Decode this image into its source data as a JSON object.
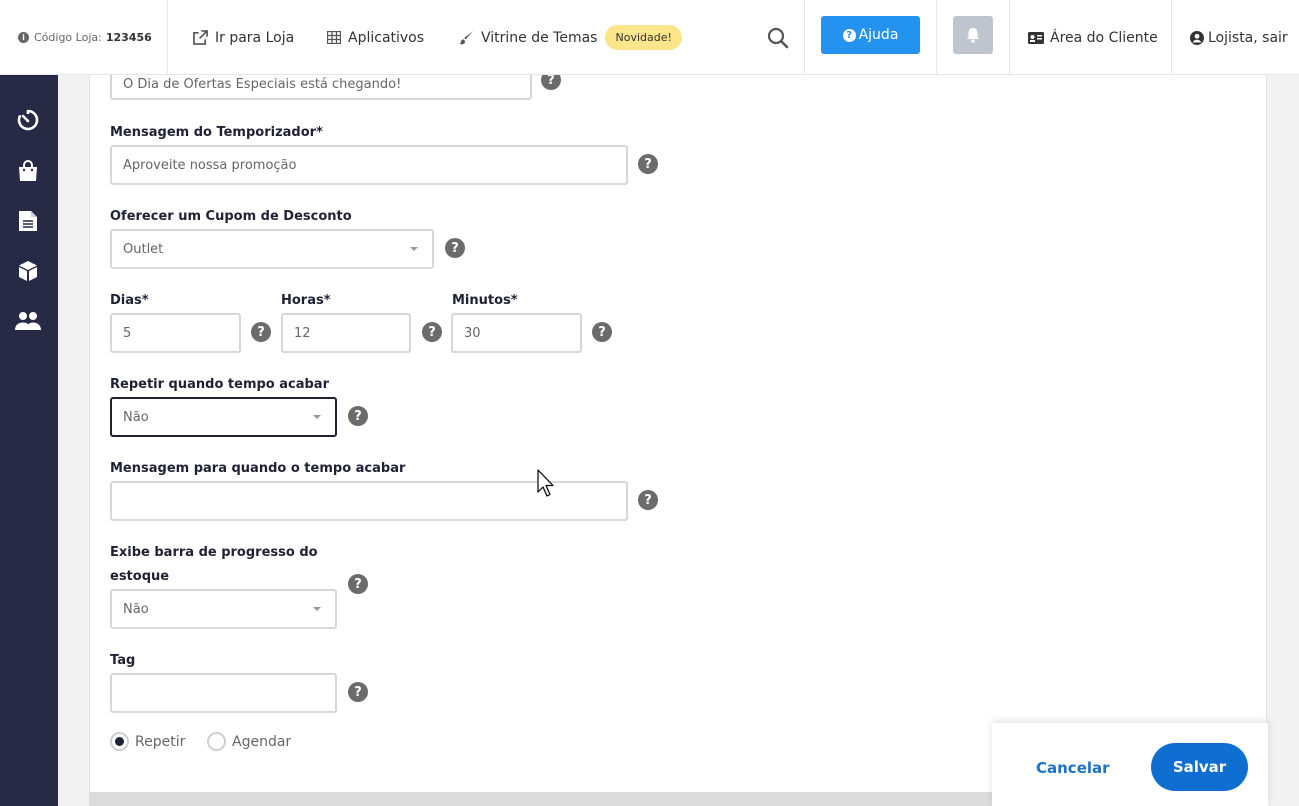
{
  "topbar": {
    "store_code_label": "Código Loja:",
    "store_code_value": "123456",
    "links": {
      "go_to_store": "Ir para Loja",
      "apps": "Aplicativos",
      "themes": "Vitrine de Temas"
    },
    "news_badge": "Novidade!",
    "help_label": "Ajuda",
    "client_area": "Área do Cliente",
    "logout": "Lojista, sair"
  },
  "sidebar": {
    "icons": [
      "timer-icon",
      "shopping-bag-icon",
      "document-icon",
      "box-icon",
      "users-icon"
    ]
  },
  "form": {
    "title_value": "O Dia de Ofertas Especiais está chegando!",
    "timer_message_label": "Mensagem do Temporizador*",
    "timer_message_value": "Aproveite nossa promoção",
    "coupon_label": "Oferecer um Cupom de Desconto",
    "coupon_value": "Outlet",
    "days_label": "Dias*",
    "days_value": "5",
    "hours_label": "Horas*",
    "hours_value": "12",
    "minutes_label": "Minutos*",
    "minutes_value": "30",
    "repeat_label": "Repetir quando tempo acabar",
    "repeat_value": "Não",
    "end_message_label": "Mensagem para quando o tempo acabar",
    "end_message_value": "",
    "progress_label_line1": "Exibe barra de progresso do",
    "progress_label_line2": "estoque",
    "progress_value": "Não",
    "tag_label": "Tag",
    "tag_value": "",
    "radio_repeat": "Repetir",
    "radio_schedule": "Agendar",
    "help_glyph": "?"
  },
  "actions": {
    "cancel": "Cancelar",
    "save": "Salvar"
  },
  "colors": {
    "sidebar": "#262a45",
    "primary": "#0f6fd0",
    "help_button": "#2493ef",
    "badge": "#fce58a"
  }
}
